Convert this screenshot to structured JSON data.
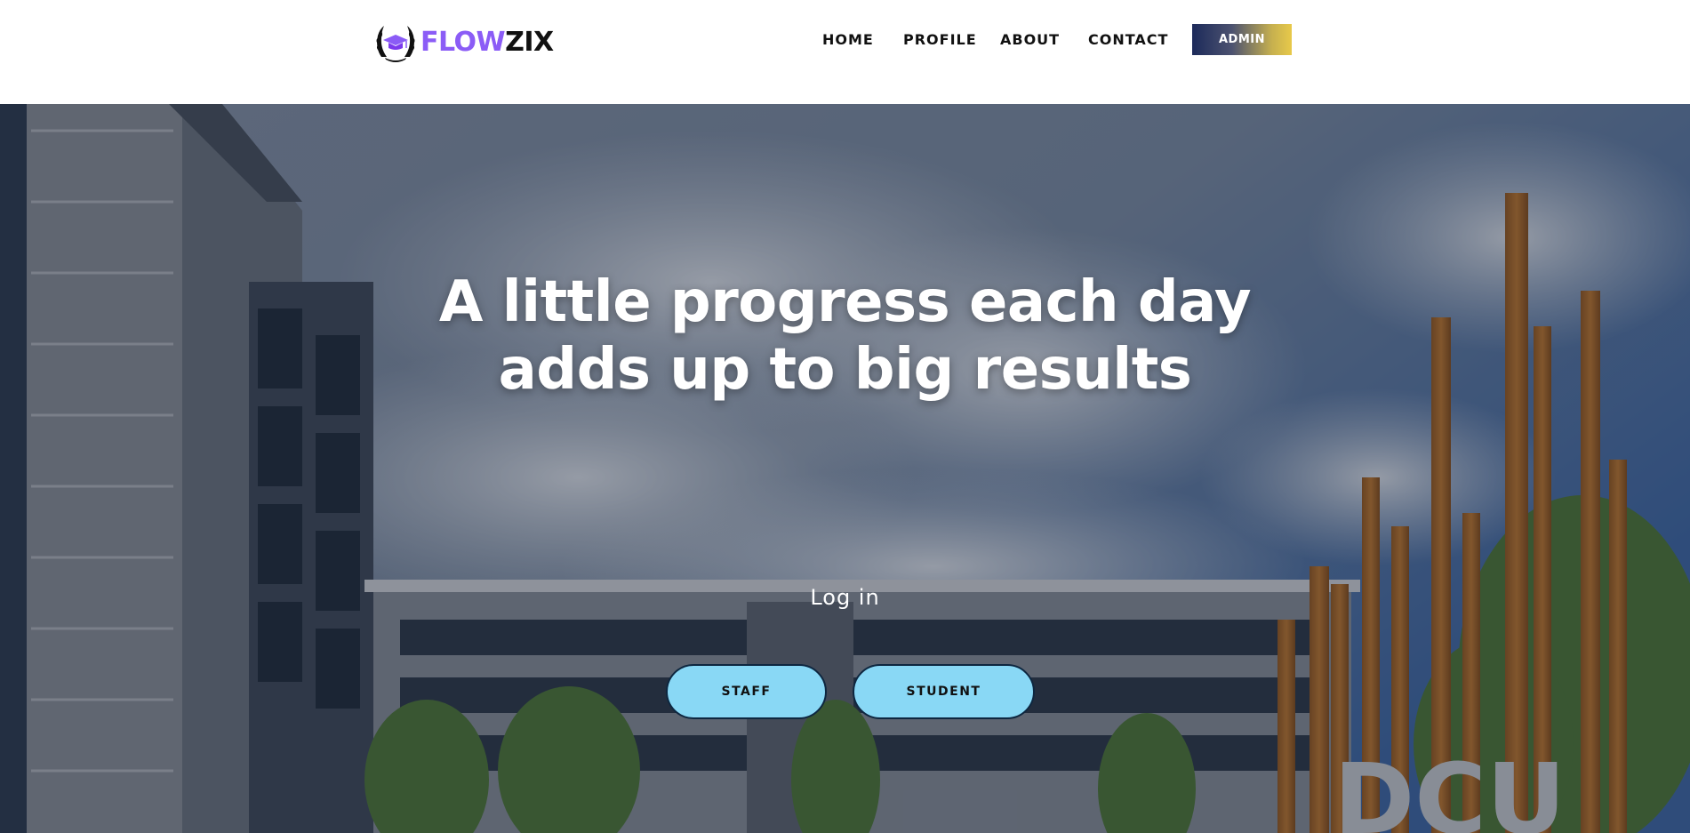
{
  "brand": {
    "name_part1": "FLOW",
    "name_part2": "ZIX",
    "emblem_icon": "graduation-cap-laurel-icon",
    "colors": {
      "accent": "#8b5cf6",
      "dark": "#111111"
    }
  },
  "nav": {
    "items": [
      {
        "label": "HOME"
      },
      {
        "label": "PROFILE"
      },
      {
        "label": "ABOUT"
      },
      {
        "label": "CONTACT"
      }
    ],
    "admin_label": "ADMIN"
  },
  "hero": {
    "headline_line1": "A little progress each day",
    "headline_line2": "adds up to big results",
    "login_label": "Log in",
    "buttons": {
      "staff_label": "STAFF",
      "student_label": "STUDENT"
    },
    "colors": {
      "button_fill": "#89d8f5",
      "button_border": "#0e2740"
    }
  }
}
